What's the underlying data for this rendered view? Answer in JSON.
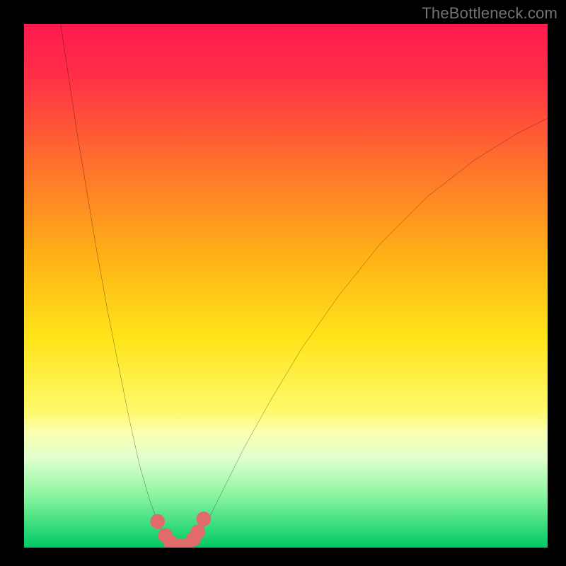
{
  "watermark": "TheBottleneck.com",
  "chart_data": {
    "type": "line",
    "title": "",
    "xlabel": "",
    "ylabel": "",
    "xlim": [
      0,
      100
    ],
    "ylim": [
      0,
      100
    ],
    "grid": false,
    "legend": false,
    "background_gradient_stops": [
      {
        "offset": 0.0,
        "color": "#ff1a4f"
      },
      {
        "offset": 0.1,
        "color": "#ff2f47"
      },
      {
        "offset": 0.25,
        "color": "#ff6a2f"
      },
      {
        "offset": 0.45,
        "color": "#ffb416"
      },
      {
        "offset": 0.6,
        "color": "#ffe41a"
      },
      {
        "offset": 0.74,
        "color": "#fff96c"
      },
      {
        "offset": 0.78,
        "color": "#fbffb0"
      },
      {
        "offset": 0.83,
        "color": "#e0ffcd"
      },
      {
        "offset": 0.9,
        "color": "#8bf5a0"
      },
      {
        "offset": 0.965,
        "color": "#2fd978"
      },
      {
        "offset": 1.0,
        "color": "#00c864"
      }
    ],
    "curve_points": [
      {
        "x": 7.0,
        "y": 100.0
      },
      {
        "x": 8.5,
        "y": 90.0
      },
      {
        "x": 10.0,
        "y": 80.0
      },
      {
        "x": 12.0,
        "y": 68.0
      },
      {
        "x": 14.0,
        "y": 56.0
      },
      {
        "x": 16.0,
        "y": 45.0
      },
      {
        "x": 18.0,
        "y": 35.0
      },
      {
        "x": 20.0,
        "y": 25.0
      },
      {
        "x": 22.0,
        "y": 16.0
      },
      {
        "x": 24.0,
        "y": 9.0
      },
      {
        "x": 25.5,
        "y": 5.0
      },
      {
        "x": 27.0,
        "y": 2.0
      },
      {
        "x": 28.5,
        "y": 0.5
      },
      {
        "x": 30.0,
        "y": 0.0
      },
      {
        "x": 31.5,
        "y": 0.5
      },
      {
        "x": 33.0,
        "y": 2.0
      },
      {
        "x": 35.0,
        "y": 5.0
      },
      {
        "x": 38.0,
        "y": 11.0
      },
      {
        "x": 42.0,
        "y": 19.0
      },
      {
        "x": 47.0,
        "y": 28.0
      },
      {
        "x": 53.0,
        "y": 38.0
      },
      {
        "x": 60.0,
        "y": 48.0
      },
      {
        "x": 68.0,
        "y": 58.0
      },
      {
        "x": 77.0,
        "y": 67.0
      },
      {
        "x": 86.0,
        "y": 74.0
      },
      {
        "x": 94.0,
        "y": 79.0
      },
      {
        "x": 100.0,
        "y": 82.0
      }
    ],
    "markers": [
      {
        "x": 25.5,
        "y": 5.0,
        "r": 1.4
      },
      {
        "x": 27.0,
        "y": 2.3,
        "r": 1.4
      },
      {
        "x": 28.0,
        "y": 1.0,
        "r": 1.4
      },
      {
        "x": 29.5,
        "y": 0.3,
        "r": 1.4
      },
      {
        "x": 31.0,
        "y": 0.4,
        "r": 1.4
      },
      {
        "x": 32.3,
        "y": 1.6,
        "r": 1.4
      },
      {
        "x": 33.2,
        "y": 3.0,
        "r": 1.4
      },
      {
        "x": 34.3,
        "y": 5.5,
        "r": 1.4
      }
    ],
    "marker_color": "#e16a6a",
    "curve_color": "#000000",
    "curve_width": 2.0
  }
}
